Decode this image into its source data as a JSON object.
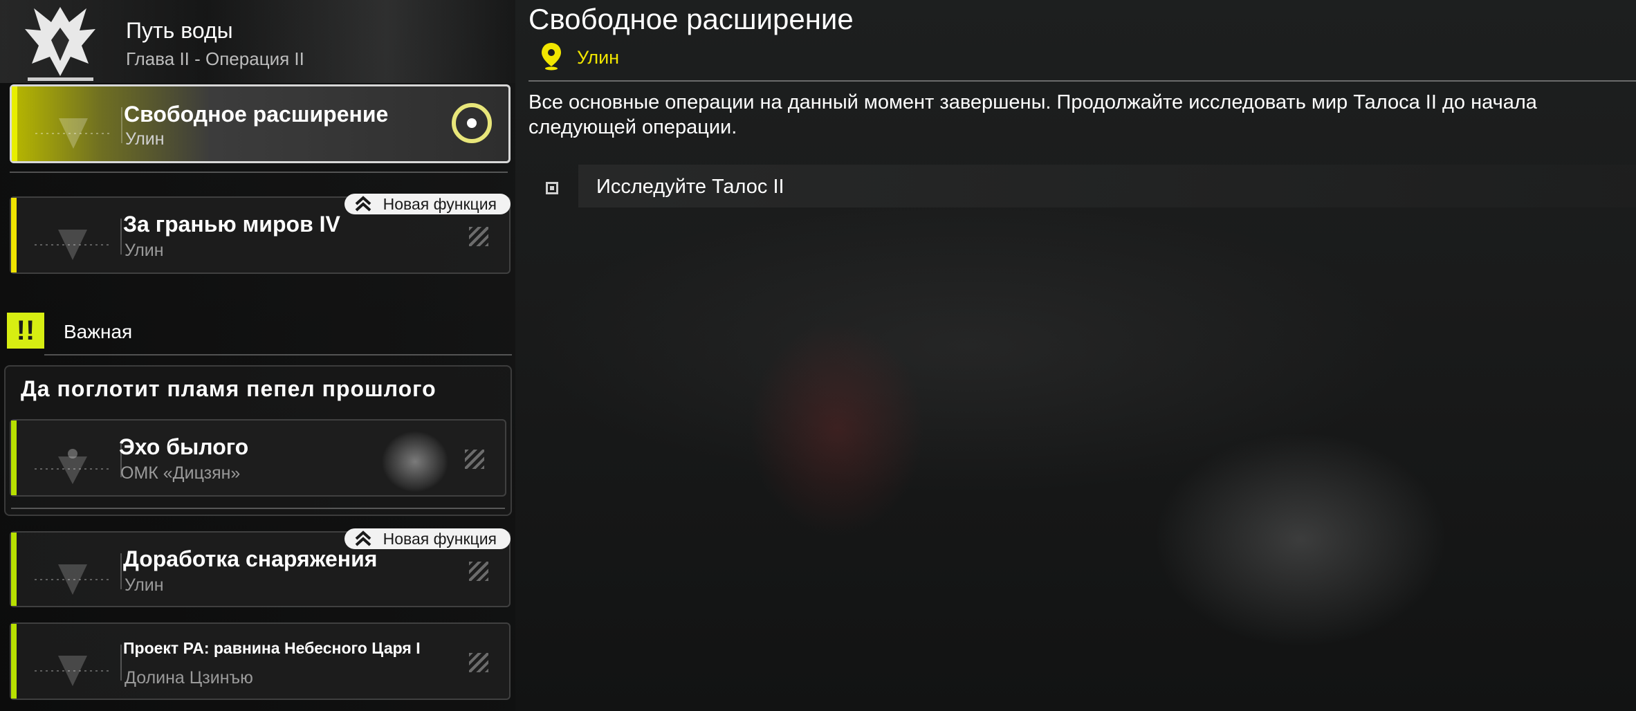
{
  "chapter": {
    "title": "Путь воды",
    "subtitle": "Глава II - Операция II"
  },
  "missions": [
    {
      "title": "Свободное расширение",
      "subtitle": "Улин",
      "selected": true,
      "stripe_color": "#e8ee00"
    },
    {
      "title": "За гранью миров IV",
      "subtitle": "Улин",
      "badge": "Новая функция",
      "stripe_color": "#f0e300"
    }
  ],
  "important_section": {
    "icon_text": "!!",
    "label": "Важная"
  },
  "group": {
    "title": "Да поглотит пламя пепел прошлого",
    "item": {
      "title": "Эхо былого",
      "subtitle": "ОМК «Дицзян»",
      "stripe_color": "#b8e000"
    }
  },
  "missions_lower": [
    {
      "title": "Доработка снаряжения",
      "subtitle": "Улин",
      "badge": "Новая функция",
      "stripe_color": "#b8e000"
    },
    {
      "title": "Проект PA: равнина Небесного Царя I",
      "subtitle": "Долина Цзинъю",
      "stripe_color": "#b8e000"
    }
  ],
  "detail": {
    "title": "Свободное расширение",
    "location": "Улин",
    "description": "Все основные операции на данный момент завершены. Продолжайте исследовать мир Талоса II до начала следующей операции.",
    "objective": "Исследуйте Талос II"
  },
  "colors": {
    "accent_yellow": "#f1e600",
    "accent_lime": "#d7ee12"
  }
}
